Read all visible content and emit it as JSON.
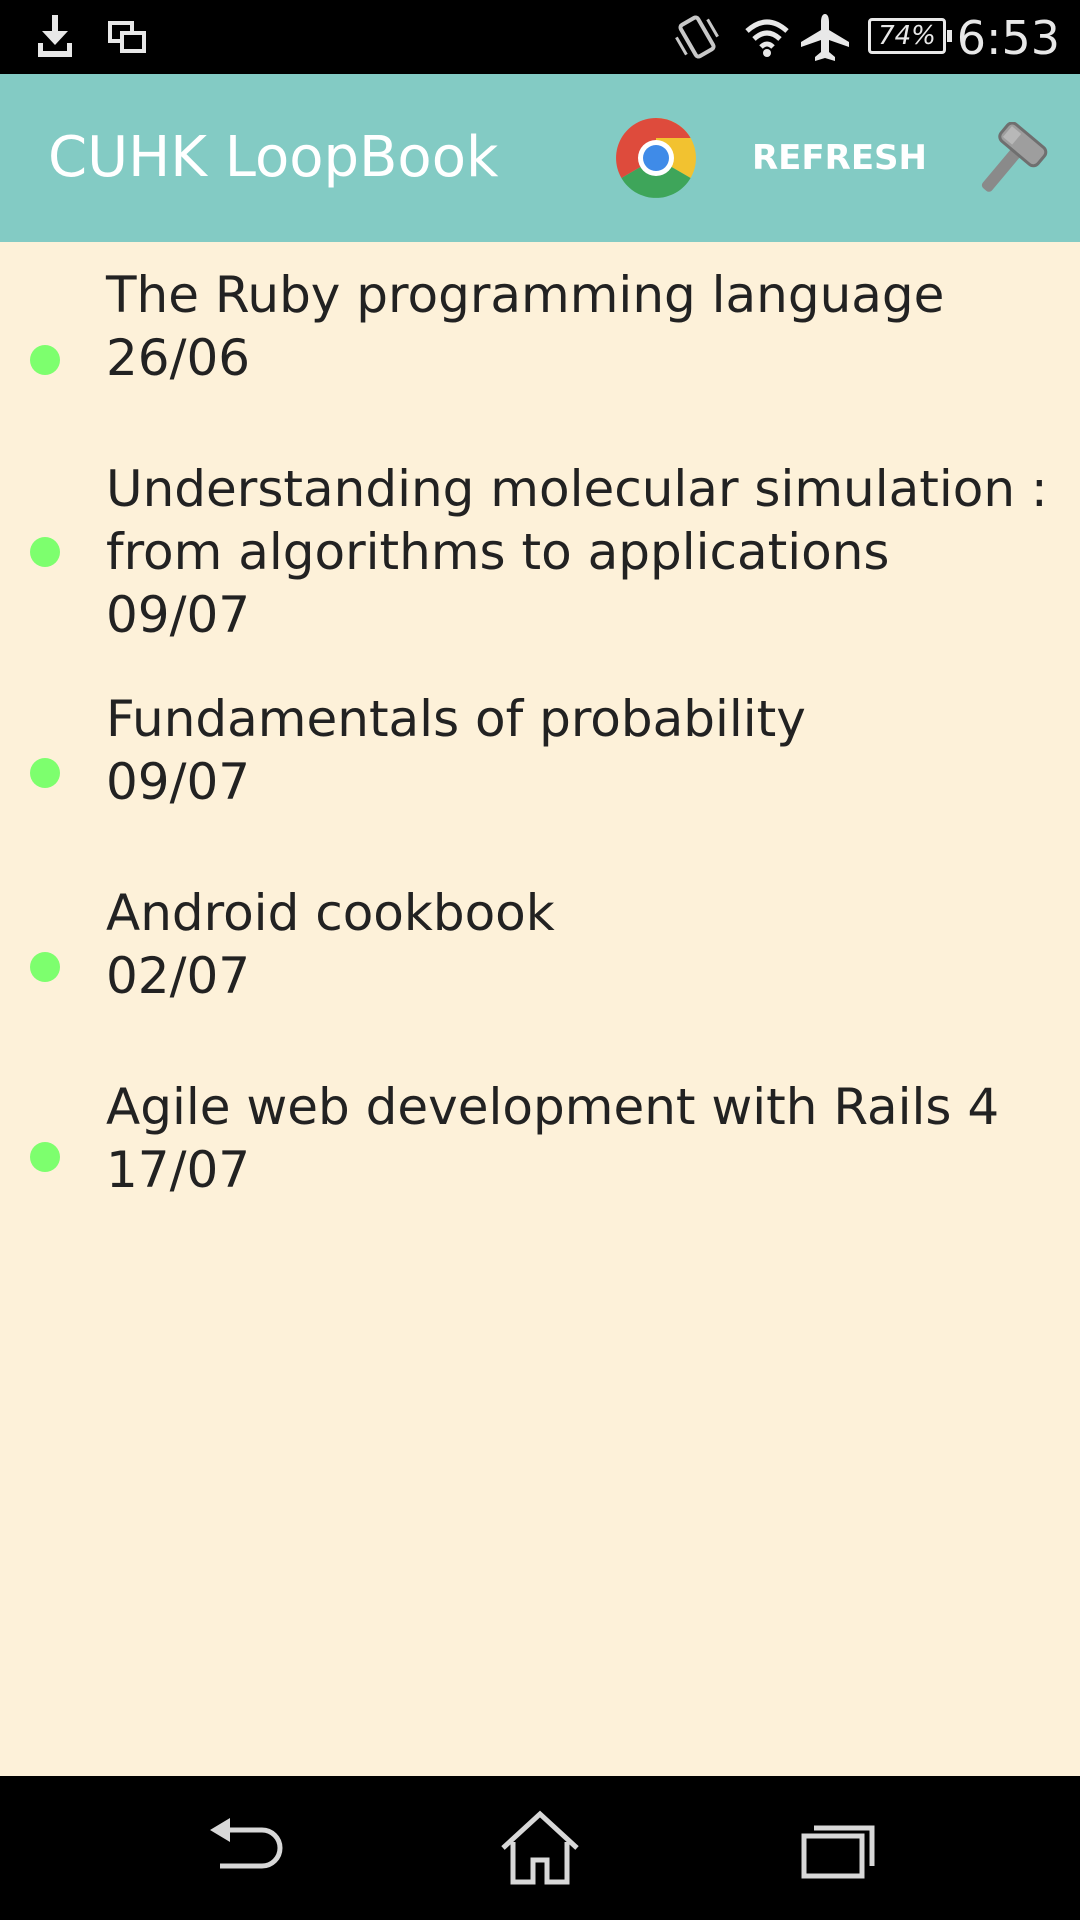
{
  "status_bar": {
    "icons": [
      "download-icon",
      "screen-mirror-icon",
      "vibrate-icon",
      "wifi-icon",
      "airplane-mode-icon"
    ],
    "battery_level": "74%",
    "time": "6:53"
  },
  "app_bar": {
    "title": "CUHK LoopBook",
    "refresh_label": "REFRESH",
    "icons": [
      "chrome-icon",
      "settings-hammer-icon"
    ],
    "color": "#83cbc4"
  },
  "books": [
    {
      "title_lines": [
        "The Ruby programming language"
      ],
      "date": "26/06"
    },
    {
      "title_lines": [
        "Understanding molecular simulation :",
        "from algorithms to applications"
      ],
      "date": "09/07"
    },
    {
      "title_lines": [
        "Fundamentals of probability"
      ],
      "date": "09/07"
    },
    {
      "title_lines": [
        "Android cookbook"
      ],
      "date": "02/07"
    },
    {
      "title_lines": [
        "Agile web development with Rails 4"
      ],
      "date": "17/07"
    }
  ],
  "colors": {
    "background": "#fdf1d9",
    "status_dot": "#7dff6e",
    "text": "#222222"
  },
  "nav_bar": {
    "icons": [
      "back-icon",
      "home-icon",
      "recent-apps-icon"
    ]
  }
}
